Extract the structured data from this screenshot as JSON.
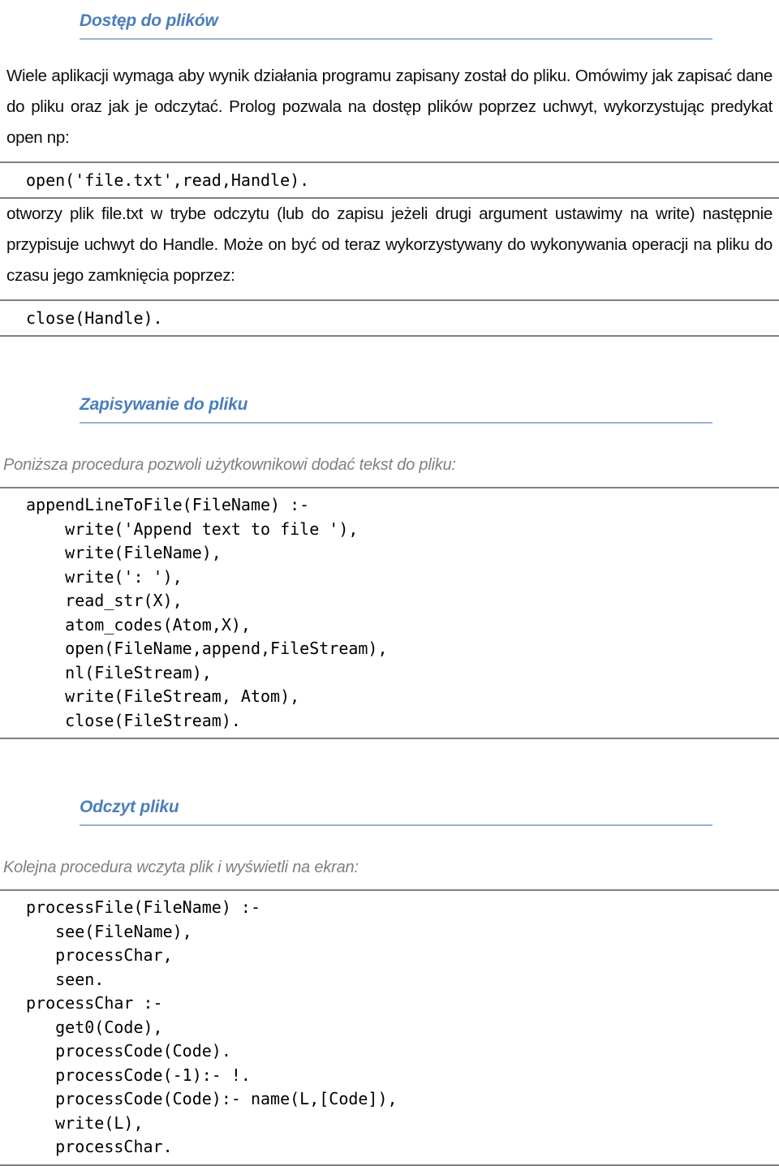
{
  "document": {
    "language": "pl",
    "accent_color": "#4a7ebb",
    "rule_color": "#95b3d7",
    "caption_color": "#808080",
    "code_rule_color": "#808080"
  },
  "sections": [
    {
      "heading": "Dostęp do plików",
      "paragraph_1": "Wiele aplikacji wymaga aby wynik działania programu zapisany został do pliku. Omówimy jak zapisać dane do pliku oraz jak je odczytać. Prolog pozwala na dostęp plików poprzez uchwyt, wykorzystując  predykat open np:",
      "code_1": "open('file.txt',read,Handle).",
      "paragraph_2": "otworzy  plik  file.txt  w  trybe  odczytu  (lub do  zapisu  jeżeli  drugi argument ustawimy na write) następnie przypisuje uchwyt do Handle. Może on być od teraz wykorzystywany  do  wykonywania operacji  na  pliku  do  czasu  jego  zamknięcia poprzez:",
      "code_2": "close(Handle)."
    },
    {
      "heading": "Zapisywanie do pliku",
      "caption": "Poniższa procedura pozwoli użytkownikowi dodać tekst do pliku:",
      "code": "appendLineToFile(FileName) :-\n    write('Append text to file '),\n    write(FileName),\n    write(': '),\n    read_str(X),\n    atom_codes(Atom,X),\n    open(FileName,append,FileStream),\n    nl(FileStream),\n    write(FileStream, Atom),\n    close(FileStream)."
    },
    {
      "heading": "Odczyt pliku",
      "caption": "Kolejna procedura wczyta plik i wyświetli na ekran:",
      "code": "processFile(FileName) :-\n   see(FileName),\n   processChar,\n   seen.\nprocessChar :-\n   get0(Code),\n   processCode(Code).\n   processCode(-1):- !.\n   processCode(Code):- name(L,[Code]),\n   write(L),\n   processChar."
    }
  ]
}
